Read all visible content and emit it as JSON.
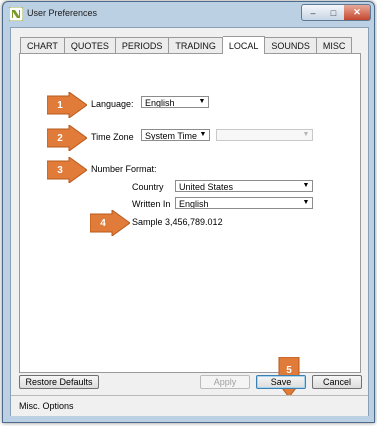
{
  "window": {
    "title": "User Preferences",
    "icon": "ninja-logo-icon"
  },
  "title_buttons": {
    "minimize": "–",
    "maximize": "□",
    "close": "✕"
  },
  "tabs": [
    {
      "label": "CHART",
      "active": false
    },
    {
      "label": "QUOTES",
      "active": false
    },
    {
      "label": "PERIODS",
      "active": false
    },
    {
      "label": "TRADING",
      "active": false
    },
    {
      "label": "LOCAL",
      "active": true
    },
    {
      "label": "SOUNDS",
      "active": false
    },
    {
      "label": "MISC",
      "active": false
    }
  ],
  "local": {
    "language_label": "Language:",
    "language_value": "English",
    "timezone_label": "Time Zone",
    "timezone_value": "System Time",
    "timezone_secondary_value": "",
    "number_format_label": "Number Format:",
    "country_label": "Country",
    "country_value": "United States",
    "written_in_label": "Written In",
    "written_in_value": "English",
    "sample_text": "Sample 3,456,789.012"
  },
  "callouts": {
    "c1": "1",
    "c2": "2",
    "c3": "3",
    "c4": "4",
    "c5": "5"
  },
  "callout_color": "#e07b39",
  "buttons": {
    "restore": "Restore Defaults",
    "apply": "Apply",
    "save": "Save",
    "cancel": "Cancel"
  },
  "status": {
    "text": "Misc. Options"
  }
}
